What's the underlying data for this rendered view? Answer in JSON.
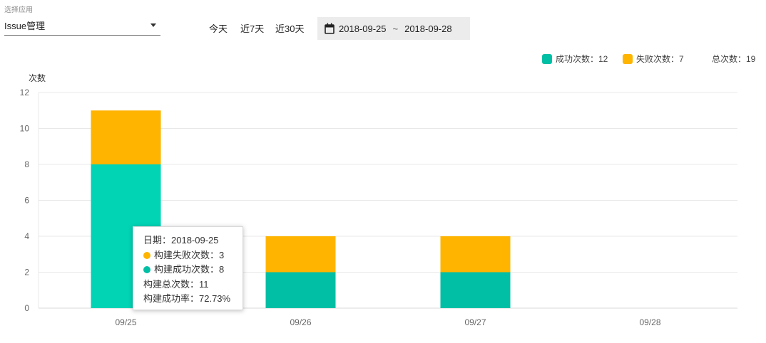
{
  "filter": {
    "app_label": "选择应用",
    "app_value": "Issue管理",
    "quick_ranges": [
      "今天",
      "近7天",
      "近30天"
    ],
    "date_start": "2018-09-25",
    "date_sep": "~",
    "date_end": "2018-09-28"
  },
  "colors": {
    "success": "#00bfa5",
    "success_light": "#00d4b5",
    "fail": "#ffb400",
    "grid": "#e8e8e8",
    "axis": "#d9d9d9"
  },
  "legend": {
    "success_label": "成功次数：12",
    "fail_label": "失败次数：7",
    "total_label": "总次数：19"
  },
  "tooltip": {
    "date": "日期：2018-09-25",
    "fail": "构建失败次数：3",
    "success": "构建成功次数：8",
    "total": "构建总次数：11",
    "rate": "构建成功率：72.73%"
  },
  "chart_data": {
    "type": "bar",
    "stacked": true,
    "categories": [
      "09/25",
      "09/26",
      "09/27",
      "09/28"
    ],
    "series": [
      {
        "name": "成功次数",
        "values": [
          8,
          2,
          2,
          0
        ]
      },
      {
        "name": "失败次数",
        "values": [
          3,
          2,
          2,
          0
        ]
      }
    ],
    "ylabel": "次数",
    "ylim": [
      0,
      12
    ],
    "yticks": [
      0,
      2,
      4,
      6,
      8,
      10,
      12
    ],
    "grid": true,
    "legend_position": "top-right",
    "highlighted_category": "09/25"
  }
}
